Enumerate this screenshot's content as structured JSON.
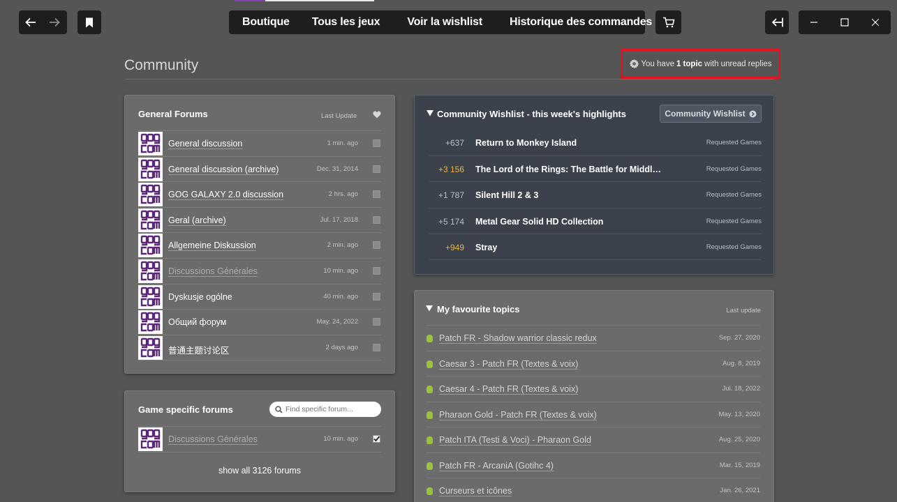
{
  "topbar": {
    "nav_items": [
      "Boutique",
      "Tous les jeux",
      "Voir la wishlist",
      "Historique des commandes"
    ]
  },
  "header": {
    "title": "Community",
    "notice": {
      "prefix": "You have",
      "bold": "1 topic",
      "suffix": "with unread replies"
    }
  },
  "general_forums": {
    "title": "General Forums",
    "last_update_label": "Last Update",
    "items": [
      {
        "name": "General discussion",
        "time": "1 min. ago",
        "style": "link"
      },
      {
        "name": "General discussion (archive)",
        "time": "Dec. 31, 2014",
        "style": "link"
      },
      {
        "name": "GOG GALAXY 2.0 discussion",
        "time": "2 hrs. ago",
        "style": "link"
      },
      {
        "name": "Geral (archive)",
        "time": "Jul. 17, 2018",
        "style": "link"
      },
      {
        "name": "Allgemeine Diskussion",
        "time": "2 min. ago",
        "style": "link"
      },
      {
        "name": "Discussions Générales",
        "time": "10 min. ago",
        "style": "muted"
      },
      {
        "name": "Dyskusje ogólne",
        "time": "40 min. ago",
        "style": "plain"
      },
      {
        "name": "Общий форум",
        "time": "May. 24, 2022",
        "style": "plain"
      },
      {
        "name": "普通主题讨论区",
        "time": "2 days ago",
        "style": "plain"
      }
    ]
  },
  "game_forums": {
    "title": "Game specific forums",
    "search_placeholder": "Find specific forum...",
    "items": [
      {
        "name": "Discussions Générales",
        "time": "10 min. ago",
        "checked": true
      }
    ],
    "show_all_label": "show all 3126 forums"
  },
  "wishlist": {
    "title": "Community Wishlist - this week's highlights",
    "button_label": "Community Wishlist",
    "items": [
      {
        "delta": "+637",
        "name": "Return to Monkey Island",
        "type": "Requested Games",
        "highlight": false
      },
      {
        "delta": "+3 156",
        "name": "The Lord of the Rings: The Battle for Middle E...",
        "type": "Requested Games",
        "highlight": true
      },
      {
        "delta": "+1 787",
        "name": "Silent Hill 2 & 3",
        "type": "Requested Games",
        "highlight": false
      },
      {
        "delta": "+5 174",
        "name": "Metal Gear Solid HD Collection",
        "type": "Requested Games",
        "highlight": false
      },
      {
        "delta": "+949",
        "name": "Stray",
        "type": "Requested Games",
        "highlight": true
      }
    ]
  },
  "favourites": {
    "title": "My favourite topics",
    "last_update_label": "Last update",
    "items": [
      {
        "name": "Patch FR - Shadow warrior classic redux",
        "date": "Sep. 27, 2020"
      },
      {
        "name": "Caesar 3 - Patch FR (Textes & voix)",
        "date": "Aug. 8, 2019"
      },
      {
        "name": "Caesar 4 - Patch FR (Textes & voix)",
        "date": "Jul. 18, 2022"
      },
      {
        "name": "Pharaon Gold - Patch FR (Textes & voix)",
        "date": "May. 13, 2020"
      },
      {
        "name": "Patch ITA (Testi & Voci) - Pharaon Gold",
        "date": "Aug. 25, 2020"
      },
      {
        "name": "Patch FR - ArcaniA (Gotihc 4)",
        "date": "Mar. 15, 2019"
      },
      {
        "name": "Curseurs et icônes",
        "date": "Jan. 26, 2021"
      }
    ]
  },
  "colors": {
    "highlight_delta": "#e3b341",
    "normal_delta": "#b9c0c8",
    "notice_border": "#e0141e",
    "fav_dot": "#9bc23c"
  }
}
